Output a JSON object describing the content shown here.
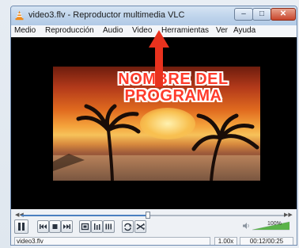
{
  "window": {
    "title": "video3.flv - Reproductor multimedia VLC",
    "buttons": {
      "minimize": "–",
      "maximize": "□",
      "close": "✕"
    }
  },
  "menu": {
    "items": [
      "Medio",
      "Reproducción",
      "Audio",
      "Video",
      "Herramientas",
      "Ver",
      "Ayuda"
    ]
  },
  "video": {
    "overlay_line1": "NOMBRE DEL",
    "overlay_line2": "PROGRAMA",
    "arrow_color": "#e8321e"
  },
  "controls": {
    "seek_fraction": 0.48,
    "seek_prev": "◀◀",
    "seek_next": "▶▶",
    "buttons": [
      "pause-icon",
      "previous-icon",
      "stop-icon",
      "next-icon",
      "fullscreen-icon",
      "extended-settings-icon",
      "playlist-icon",
      "loop-icon",
      "random-icon"
    ],
    "volume_percent": "100%",
    "volume_fraction": 1.0
  },
  "status": {
    "file": "video3.flv",
    "speed": "1.00x",
    "time": "00:12/00:25"
  },
  "colors": {
    "accent": "#4a7fc0",
    "overlay_text": "#ff3c2c",
    "vlc_orange": "#f08a18"
  }
}
